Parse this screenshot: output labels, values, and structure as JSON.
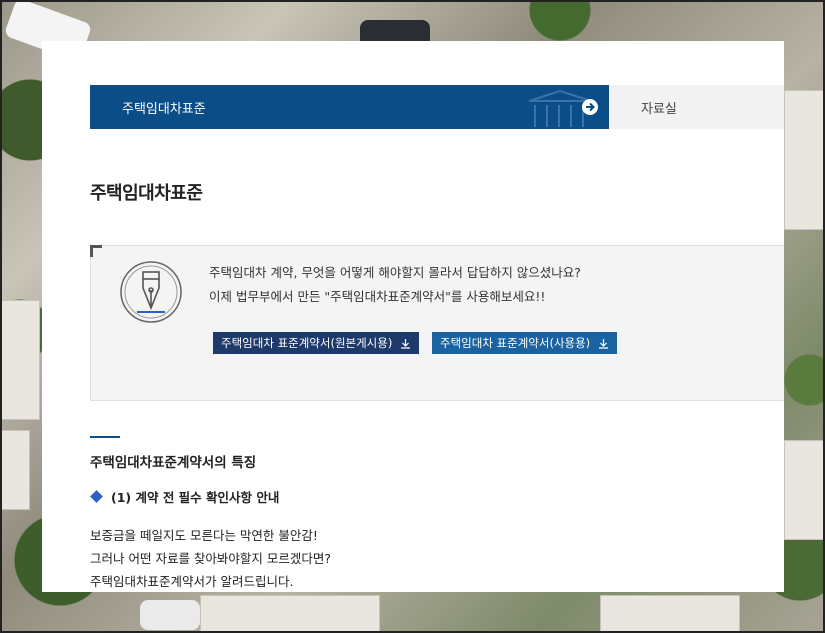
{
  "nav": {
    "current_label": "주택임대차표준",
    "next_label": "자료실"
  },
  "page": {
    "title": "주택임대차표준"
  },
  "info": {
    "line1": "주택임대차 계약, 무엇을 어떻게 해야할지 몰라서 답답하지 않으셨나요?",
    "line2": "이제 법무부에서 만든 \"주택임대차표준계약서\"를 사용해보세요!!",
    "buttons": [
      {
        "label": "주택임대차 표준계약서(원본게시용)",
        "icon": "download-icon"
      },
      {
        "label": "주택임대차 표준계약서(사용용)",
        "icon": "download-icon"
      }
    ]
  },
  "section": {
    "title": "주택임대차표준계약서의 특징",
    "sub_heading": "(1) 계약 전 필수 확인사항 안내",
    "paragraph": [
      "보증금을 떼일지도 모른다는 막연한 불안감!",
      "그러나 어떤 자료를 찾아봐야할지 모르겠다면?",
      "주택임대차표준계약서가 알려드립니다."
    ]
  },
  "colors": {
    "nav_active": "#0b4d86",
    "button_primary": "#1d3a6b",
    "button_secondary": "#1a63a0",
    "bullet": "#2f5fc6"
  }
}
